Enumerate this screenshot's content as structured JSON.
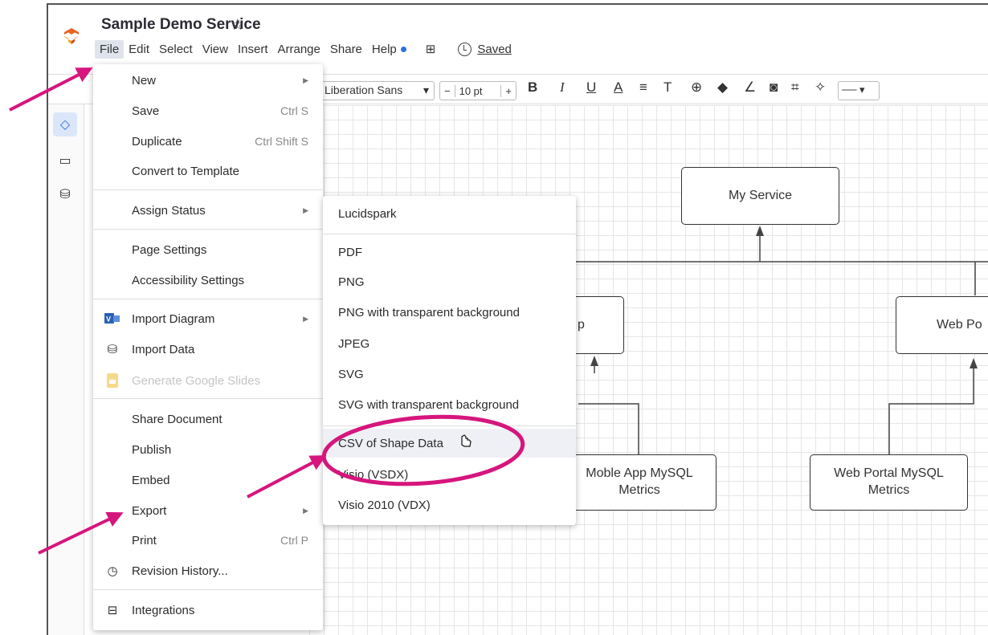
{
  "app": {
    "title": "Sample Demo Service",
    "saved_label": "Saved"
  },
  "menubar": {
    "items": [
      "File",
      "Edit",
      "Select",
      "View",
      "Insert",
      "Arrange",
      "Share",
      "Help"
    ]
  },
  "toolbar": {
    "font_name": "Liberation Sans",
    "font_size": "10 pt",
    "minus": "−",
    "plus": "+",
    "bold": "B",
    "italic": "I",
    "underline": "U",
    "font_color": "A"
  },
  "file_menu": {
    "items": [
      {
        "label": "New",
        "shortcut": "",
        "submenu": true
      },
      {
        "label": "Save",
        "shortcut": "Ctrl S"
      },
      {
        "label": "Duplicate",
        "shortcut": "Ctrl Shift S"
      },
      {
        "label": "Convert to Template",
        "shortcut": ""
      },
      {
        "label": "Assign Status",
        "shortcut": "",
        "submenu": true
      },
      {
        "label": "Page Settings",
        "shortcut": ""
      },
      {
        "label": "Accessibility Settings",
        "shortcut": ""
      },
      {
        "label": "Import Diagram",
        "shortcut": "",
        "submenu": true,
        "icon": "visio-icon"
      },
      {
        "label": "Import Data",
        "shortcut": "",
        "icon": "database-icon"
      },
      {
        "label": "Generate Google Slides",
        "shortcut": "",
        "disabled": true,
        "icon": "slides-icon"
      },
      {
        "label": "Share Document",
        "shortcut": ""
      },
      {
        "label": "Publish",
        "shortcut": ""
      },
      {
        "label": "Embed",
        "shortcut": ""
      },
      {
        "label": "Export",
        "shortcut": "",
        "submenu": true
      },
      {
        "label": "Print",
        "shortcut": "Ctrl P"
      },
      {
        "label": "Revision History...",
        "shortcut": "",
        "icon": "history-icon"
      },
      {
        "label": "Integrations",
        "shortcut": "",
        "icon": "briefcase-icon"
      }
    ]
  },
  "export_menu": {
    "items": [
      {
        "label": "Lucidspark"
      },
      {
        "label": "PDF"
      },
      {
        "label": "PNG"
      },
      {
        "label": "PNG with transparent background"
      },
      {
        "label": "JPEG"
      },
      {
        "label": "SVG"
      },
      {
        "label": "SVG with transparent background"
      },
      {
        "label": "CSV of Shape Data",
        "highlighted": true
      },
      {
        "label": "Visio (VSDX)"
      },
      {
        "label": "Visio 2010 (VDX)"
      }
    ]
  },
  "diagram": {
    "nodes": {
      "my_service": "My Service",
      "mobile_app_partial": "p",
      "web_portal_partial": "Web Po",
      "mobile_mysql": "Moble App MySQL Metrics",
      "web_mysql": "Web Portal MySQL Metrics"
    }
  },
  "colors": {
    "annotation": "#d6157d",
    "accent": "#2f6fe0",
    "logo": "#e8641f"
  }
}
